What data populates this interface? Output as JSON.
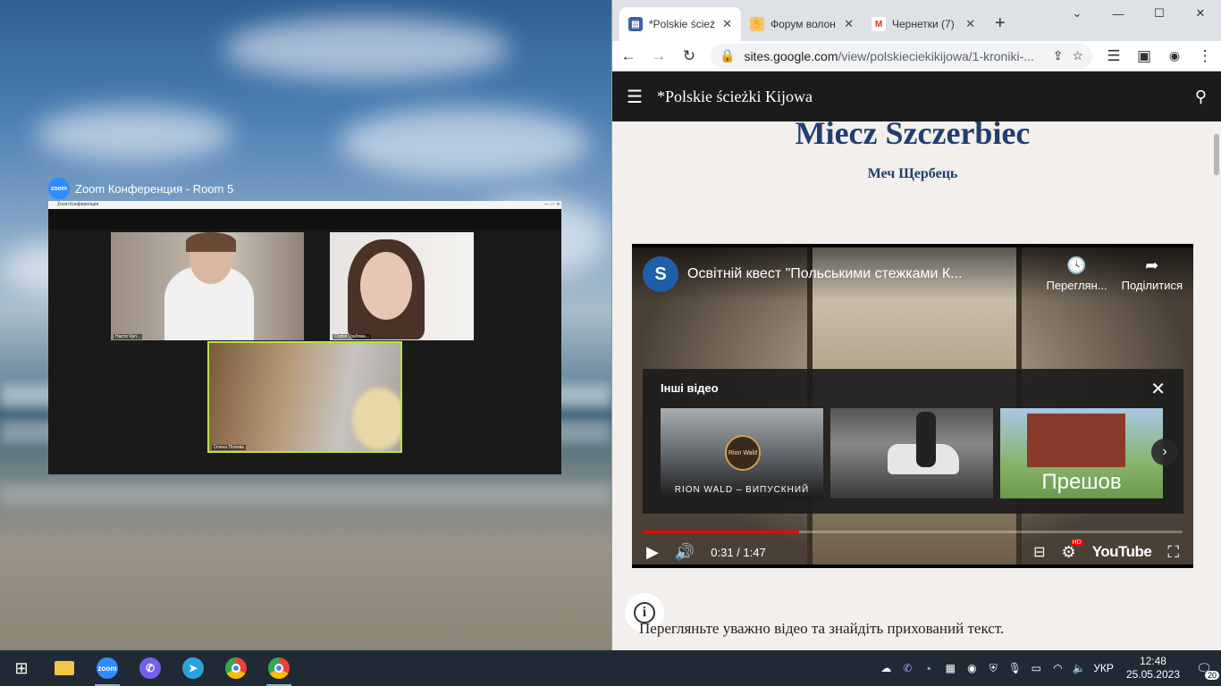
{
  "zoom": {
    "window_label": "Zoom Конференция - Room 5",
    "titlebar": "Zoom Конференция",
    "logo_text": "zoom",
    "participants": [
      {
        "name": "Настя Чуп..."
      },
      {
        "name": "Софія Грабова..."
      },
      {
        "name": "Олена Попова"
      }
    ]
  },
  "browser": {
    "tabs": [
      {
        "title": "*Polskie ścież",
        "favicon": "google-sites-icon",
        "active": true
      },
      {
        "title": "Форум волон",
        "favicon": "hand-icon",
        "active": false
      },
      {
        "title": "Чернетки (7)",
        "favicon": "gmail-icon",
        "active": false
      }
    ],
    "url_host": "sites.google.com",
    "url_path": "/view/polskieciekikijowa/1-kroniki-..."
  },
  "site": {
    "title": "*Polskie ścieżki Kijowa",
    "heading": "Miecz Szczerbiec",
    "subheading": "Меч Щербець",
    "instruction": "Перегляньте уважно відео та знайдіть прихований текст."
  },
  "video": {
    "channel_initial": "S",
    "title": "Освітній квест \"Польськими стежками К...",
    "watch_later": "Переглян...",
    "share": "Поділитися",
    "more_videos_title": "Інші відео",
    "thumbs": [
      {
        "caption": "RION WALD – ВИПУСКНИЙ",
        "logo": "Rion Wald"
      },
      {
        "caption": ""
      },
      {
        "caption": "Прешов"
      }
    ],
    "time": "0:31 / 1:47",
    "progress": 0.29,
    "youtube_label": "YouTube",
    "hd_badge": "HD"
  },
  "taskbar": {
    "apps": [
      "windows-start-icon",
      "file-explorer-icon",
      "zoom-icon",
      "viber-icon",
      "telegram-icon",
      "chrome-icon",
      "chrome-profile-icon"
    ],
    "zoom_label": "zoom",
    "language": "УКР",
    "time": "12:48",
    "date": "25.05.2023",
    "notifications": "20"
  }
}
